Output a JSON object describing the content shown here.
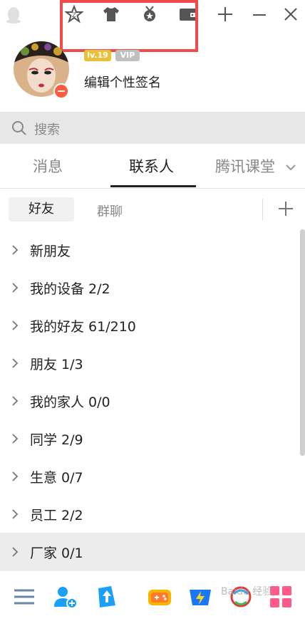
{
  "header": {
    "toolbar_icons": [
      "zone-icon",
      "skin-icon",
      "medal-icon",
      "wallet-icon",
      "plus-icon",
      "minimize-icon",
      "close-icon"
    ],
    "badge_a": "lv.19",
    "badge_b": "VIP",
    "signature": "编辑个性签名"
  },
  "search": {
    "placeholder": "搜索"
  },
  "tabs": [
    {
      "label": "消息",
      "active": false
    },
    {
      "label": "联系人",
      "active": true
    },
    {
      "label": "腾讯课堂",
      "active": false
    }
  ],
  "subtabs": {
    "active": "好友",
    "other": "群聊"
  },
  "groups": [
    {
      "label": "新朋友"
    },
    {
      "label": "我的设备 2/2"
    },
    {
      "label": "我的好友 61/210"
    },
    {
      "label": "朋友 1/3"
    },
    {
      "label": "我的家人 0/0"
    },
    {
      "label": "同学 2/9"
    },
    {
      "label": "生意 0/7"
    },
    {
      "label": "员工 2/2"
    },
    {
      "label": "厂家 0/1"
    }
  ],
  "bottom_icons": [
    "menu-icon",
    "add-friend-icon",
    "file-transfer-icon",
    "game-icon",
    "live-icon",
    "tencent-video-icon",
    "apps-icon"
  ],
  "colors": {
    "highlight": "#f04a4a",
    "search_bg": "#e7e7e7",
    "hover_bg": "#ececec",
    "accent_blue": "#1aa1f7"
  },
  "watermark": "Baidu 经验"
}
